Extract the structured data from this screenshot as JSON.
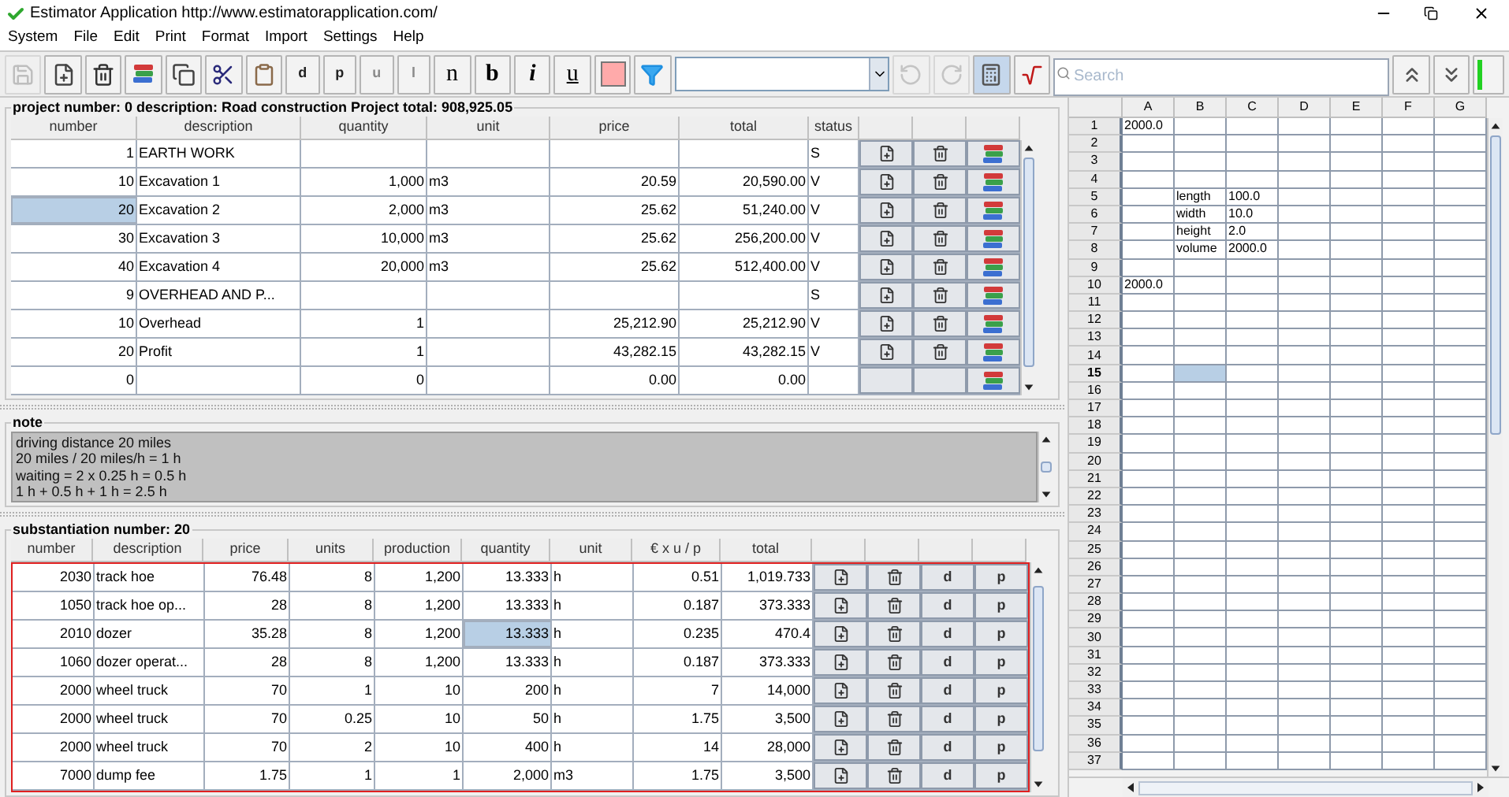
{
  "window": {
    "title": "Estimator Application http://www.estimatorapplication.com/"
  },
  "menu": [
    {
      "label": "System"
    },
    {
      "label": "File"
    },
    {
      "label": "Edit"
    },
    {
      "label": "Print"
    },
    {
      "label": "Format"
    },
    {
      "label": "Import"
    },
    {
      "label": "Settings"
    },
    {
      "label": "Help"
    }
  ],
  "toolbar": {
    "tools": [
      {
        "kind": "save",
        "disabled": true,
        "pressed": false
      },
      {
        "kind": "new",
        "disabled": false,
        "pressed": false
      },
      {
        "kind": "delete",
        "disabled": false,
        "pressed": false
      },
      {
        "kind": "books",
        "disabled": false,
        "pressed": false
      },
      {
        "kind": "copy",
        "disabled": false,
        "pressed": false
      },
      {
        "kind": "cut",
        "disabled": false,
        "pressed": false
      },
      {
        "kind": "paste",
        "disabled": false,
        "pressed": false
      },
      {
        "kind": "letter",
        "label": "d",
        "disabled": false,
        "pressed": false
      },
      {
        "kind": "letter",
        "label": "p",
        "disabled": false,
        "pressed": false
      },
      {
        "kind": "letter",
        "label": "u",
        "disabled": true,
        "pressed": false
      },
      {
        "kind": "letter",
        "label": "l",
        "disabled": true,
        "pressed": false
      },
      {
        "kind": "normal",
        "label": "n",
        "disabled": false,
        "pressed": false
      },
      {
        "kind": "bold",
        "label": "b",
        "disabled": false,
        "pressed": false
      },
      {
        "kind": "italic",
        "label": "i",
        "disabled": false,
        "pressed": false
      },
      {
        "kind": "underline",
        "label": "u",
        "disabled": false,
        "pressed": false
      },
      {
        "kind": "color",
        "color": "#ffaaaa",
        "disabled": false,
        "pressed": false
      },
      {
        "kind": "filter",
        "disabled": false,
        "pressed": false
      },
      {
        "kind": "dropdown",
        "disabled": false
      },
      {
        "kind": "undo",
        "disabled": true,
        "pressed": false
      },
      {
        "kind": "redo",
        "disabled": true,
        "pressed": false
      },
      {
        "kind": "calculator",
        "disabled": false,
        "pressed": true
      },
      {
        "kind": "formula",
        "disabled": false,
        "pressed": false
      },
      {
        "kind": "search",
        "placeholder": "Search"
      },
      {
        "kind": "up",
        "disabled": false,
        "pressed": false
      },
      {
        "kind": "down",
        "disabled": false,
        "pressed": false
      },
      {
        "kind": "indicator"
      }
    ]
  },
  "project": {
    "header": "project number: 0 description: Road construction Project total: 908,925.05",
    "columns": [
      "number",
      "description",
      "quantity",
      "unit",
      "price",
      "total",
      "status"
    ],
    "rows": [
      {
        "number": "1",
        "description": "EARTH WORK",
        "status": "S",
        "selected": false,
        "editable": true
      },
      {
        "number": "10",
        "description": "Excavation 1",
        "quantity": "1,000",
        "unit": "m3",
        "price": "20.59",
        "total": "20,590.00",
        "status": "V",
        "selected": false,
        "editable": true
      },
      {
        "number": "20",
        "description": "Excavation 2",
        "quantity": "2,000",
        "unit": "m3",
        "price": "25.62",
        "total": "51,240.00",
        "status": "V",
        "selected": true,
        "editable": true
      },
      {
        "number": "30",
        "description": "Excavation 3",
        "quantity": "10,000",
        "unit": "m3",
        "price": "25.62",
        "total": "256,200.00",
        "status": "V",
        "selected": false,
        "editable": true
      },
      {
        "number": "40",
        "description": "Excavation 4",
        "quantity": "20,000",
        "unit": "m3",
        "price": "25.62",
        "total": "512,400.00",
        "status": "V",
        "selected": false,
        "editable": true
      },
      {
        "number": "9",
        "description": "OVERHEAD AND P...",
        "status": "S",
        "selected": false,
        "editable": true
      },
      {
        "number": "10",
        "description": "Overhead",
        "quantity": "1",
        "price": "25,212.90",
        "total": "25,212.90",
        "status": "V",
        "selected": false,
        "editable": true
      },
      {
        "number": "20",
        "description": "Profit",
        "quantity": "1",
        "price": "43,282.15",
        "total": "43,282.15",
        "status": "V",
        "selected": false,
        "editable": true
      },
      {
        "number": "0",
        "quantity": "0",
        "price": "0.00",
        "total": "0.00",
        "selected": false,
        "editable": false
      }
    ]
  },
  "note": {
    "title": "note",
    "lines": [
      "driving distance 20 miles",
      "20 miles / 20 miles/h = 1 h",
      "waiting = 2 x 0.25 h = 0.5 h",
      "1 h + 0.5 h + 1 h = 2.5 h"
    ]
  },
  "substantiation": {
    "header": "substantiation number: 20",
    "columns": [
      "number",
      "description",
      "price",
      "units",
      "production",
      "quantity",
      "unit",
      "€ x u / p",
      "total"
    ],
    "rows": [
      {
        "number": "2030",
        "description": "track hoe",
        "price": "76.48",
        "units": "8",
        "production": "1,200",
        "quantity": "13.333",
        "unit": "h",
        "rate": "0.51",
        "total": "1,019.733",
        "actions": [
          "d",
          "p"
        ],
        "selected": false
      },
      {
        "number": "1050",
        "description": "track hoe op...",
        "price": "28",
        "units": "8",
        "production": "1,200",
        "quantity": "13.333",
        "unit": "h",
        "rate": "0.187",
        "total": "373.333",
        "actions": [
          "d",
          "p"
        ],
        "selected": false
      },
      {
        "number": "2010",
        "description": "dozer",
        "price": "35.28",
        "units": "8",
        "production": "1,200",
        "quantity": "13.333",
        "unit": "h",
        "rate": "0.235",
        "total": "470.4",
        "actions": [
          "d",
          "p"
        ],
        "selected": true
      },
      {
        "number": "1060",
        "description": "dozer operat...",
        "price": "28",
        "units": "8",
        "production": "1,200",
        "quantity": "13.333",
        "unit": "h",
        "rate": "0.187",
        "total": "373.333",
        "actions": [
          "d",
          "p"
        ],
        "selected": false
      },
      {
        "number": "2000",
        "description": "wheel truck",
        "price": "70",
        "units": "1",
        "production": "10",
        "quantity": "200",
        "unit": "h",
        "rate": "7",
        "total": "14,000",
        "actions": [
          "d",
          "p"
        ],
        "selected": false
      },
      {
        "number": "2000",
        "description": "wheel truck",
        "price": "70",
        "units": "0.25",
        "production": "10",
        "quantity": "50",
        "unit": "h",
        "rate": "1.75",
        "total": "3,500",
        "actions": [
          "d",
          "p"
        ],
        "selected": false
      },
      {
        "number": "2000",
        "description": "wheel truck",
        "price": "70",
        "units": "2",
        "production": "10",
        "quantity": "400",
        "unit": "h",
        "rate": "14",
        "total": "28,000",
        "actions": [
          "d",
          "p"
        ],
        "selected": false
      },
      {
        "number": "7000",
        "description": "dump fee",
        "price": "1.75",
        "units": "1",
        "production": "1",
        "quantity": "2,000",
        "unit": "m3",
        "rate": "1.75",
        "total": "3,500",
        "actions": [
          "d",
          "p"
        ],
        "selected": false
      }
    ]
  },
  "spreadsheet": {
    "columns": [
      "A",
      "B",
      "C",
      "D",
      "E",
      "F",
      "G"
    ],
    "rows": [
      {
        "label": "1",
        "selected": false,
        "cells": {
          "A": {
            "text": "2000.0",
            "selected": false
          }
        }
      },
      {
        "label": "2",
        "selected": false
      },
      {
        "label": "3",
        "selected": false
      },
      {
        "label": "4",
        "selected": false
      },
      {
        "label": "5",
        "selected": false,
        "cells": {
          "B": {
            "text": "length",
            "selected": false
          },
          "C": {
            "text": "100.0",
            "selected": false
          }
        }
      },
      {
        "label": "6",
        "selected": false,
        "cells": {
          "B": {
            "text": "width",
            "selected": false
          },
          "C": {
            "text": "10.0",
            "selected": false
          }
        }
      },
      {
        "label": "7",
        "selected": false,
        "cells": {
          "B": {
            "text": "height",
            "selected": false
          },
          "C": {
            "text": "2.0",
            "selected": false
          }
        }
      },
      {
        "label": "8",
        "selected": false,
        "cells": {
          "B": {
            "text": "volume",
            "selected": false
          },
          "C": {
            "text": "2000.0",
            "selected": false
          }
        }
      },
      {
        "label": "9",
        "selected": false
      },
      {
        "label": "10",
        "selected": false,
        "cells": {
          "A": {
            "text": "2000.0",
            "selected": false
          }
        }
      },
      {
        "label": "11",
        "selected": false
      },
      {
        "label": "12",
        "selected": false
      },
      {
        "label": "13",
        "selected": false
      },
      {
        "label": "14",
        "selected": false
      },
      {
        "label": "15",
        "selected": true,
        "cells": {
          "B": {
            "selected": true
          }
        }
      },
      {
        "label": "16",
        "selected": false
      },
      {
        "label": "17",
        "selected": false
      },
      {
        "label": "18",
        "selected": false
      },
      {
        "label": "19",
        "selected": false
      },
      {
        "label": "20",
        "selected": false
      },
      {
        "label": "21",
        "selected": false
      },
      {
        "label": "22",
        "selected": false
      },
      {
        "label": "23",
        "selected": false
      },
      {
        "label": "24",
        "selected": false
      },
      {
        "label": "25",
        "selected": false
      },
      {
        "label": "26",
        "selected": false
      },
      {
        "label": "27",
        "selected": false
      },
      {
        "label": "28",
        "selected": false
      },
      {
        "label": "29",
        "selected": false
      },
      {
        "label": "30",
        "selected": false
      },
      {
        "label": "31",
        "selected": false
      },
      {
        "label": "32",
        "selected": false
      },
      {
        "label": "33",
        "selected": false
      },
      {
        "label": "34",
        "selected": false
      },
      {
        "label": "35",
        "selected": false
      },
      {
        "label": "36",
        "selected": false
      },
      {
        "label": "37",
        "selected": false
      }
    ]
  }
}
